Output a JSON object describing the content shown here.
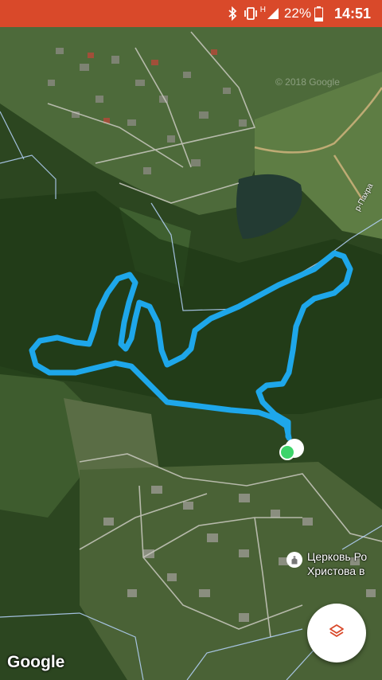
{
  "status_bar": {
    "battery_percent": "22%",
    "time": "14:51",
    "network_label": "H",
    "icons": [
      "bluetooth-icon",
      "vibrate-icon",
      "signal-icon",
      "battery-icon"
    ]
  },
  "map": {
    "poi_label_line1": "Церковь Ро",
    "poi_label_line2": "Христова в",
    "road_label": "р-Пахра",
    "watermark": "© 2018 Google",
    "google_logo": "Google",
    "route_color": "#1ea7ea",
    "start_marker_color": "#3dd46a"
  },
  "controls": {
    "layers_icon": "layers-icon",
    "accent": "#d9492a"
  }
}
